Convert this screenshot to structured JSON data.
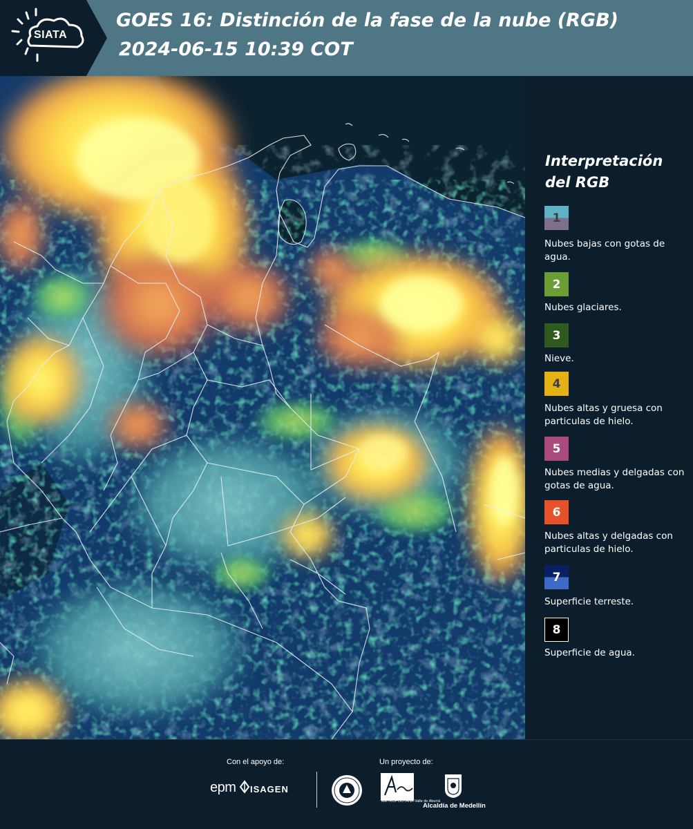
{
  "header": {
    "logo_text": "SIATA",
    "title_line1": "GOES 16: Distinción de la fase de la nube (RGB)",
    "title_line2": "2024-06-15 10:39 COT"
  },
  "map": {
    "icon": "satellite-rgb-map"
  },
  "legend": {
    "title": "Interpretación\ndel RGB",
    "items": [
      {
        "number": "1",
        "label": "Nubes bajas con gotas de agua.",
        "color_top": "#5fb2c3",
        "color_bottom": "#7e6f8e",
        "text_color": "#3d3d4a"
      },
      {
        "number": "2",
        "label": "Nubes glaciares.",
        "color_top": "#6a9d35",
        "color_bottom": "#6a9d35",
        "text_color": "#ffffff"
      },
      {
        "number": "3",
        "label": "Nieve.",
        "color_top": "#2f5a1d",
        "color_bottom": "#2f5a1d",
        "text_color": "#ffffff"
      },
      {
        "number": "4",
        "label": "Nubes altas y gruesa con particulas de hielo.",
        "color_top": "#e4b215",
        "color_bottom": "#e4b215",
        "text_color": "#3d3d4a"
      },
      {
        "number": "5",
        "label": "Nubes medias y delgadas con gotas de agua.",
        "color_top": "#a84a7d",
        "color_bottom": "#a84a7d",
        "text_color": "#ffffff"
      },
      {
        "number": "6",
        "label": "Nubes altas y delgadas con particulas de hielo.",
        "color_top": "#e5512b",
        "color_bottom": "#e5512b",
        "text_color": "#ffffff"
      },
      {
        "number": "7",
        "label": "Superficie terreste.",
        "color_top": "#0b1f63",
        "color_bottom": "#3d6ac6",
        "text_color": "#ffffff"
      },
      {
        "number": "8",
        "label": "Superficie de agua.",
        "color_top": "#000000",
        "color_bottom": "#000000",
        "text_color": "#ffffff"
      }
    ]
  },
  "footer": {
    "support_label": "Con el apoyo de:",
    "project_label": "Un proyecto de:",
    "epm": "epm",
    "isagen": "ISAGEN",
    "metropolitana": "METROPOLITANA Valle de Aburrá",
    "alcaldia": "Alcaldía de Medellín"
  }
}
